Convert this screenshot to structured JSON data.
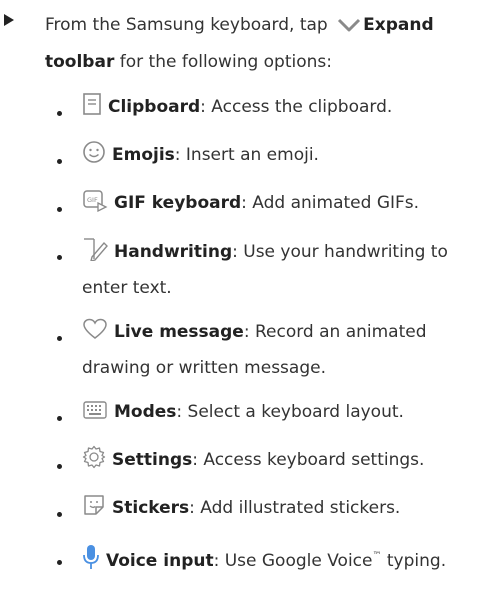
{
  "intro": {
    "before": "From the Samsung keyboard, tap ",
    "expand_bold": "Expand toolbar",
    "after": " for the following options:"
  },
  "options": [
    {
      "icon": "clipboard-icon",
      "label": "Clipboard",
      "desc": ": Access the clipboard."
    },
    {
      "icon": "emoji-icon",
      "label": "Emojis",
      "desc": ": Insert an emoji."
    },
    {
      "icon": "gif-icon",
      "label": "GIF keyboard",
      "desc": ": Add animated GIFs."
    },
    {
      "icon": "handwriting-icon",
      "label": "Handwriting",
      "desc": ": Use your handwriting to enter text."
    },
    {
      "icon": "live-message-icon",
      "label": "Live message",
      "desc": ": Record an animated drawing or written message."
    },
    {
      "icon": "keyboard-modes-icon",
      "label": "Modes",
      "desc": ": Select a keyboard layout."
    },
    {
      "icon": "settings-gear-icon",
      "label": "Settings",
      "desc": ": Access keyboard settings."
    },
    {
      "icon": "sticker-icon",
      "label": "Stickers",
      "desc": ": Add illustrated stickers."
    },
    {
      "icon": "microphone-icon",
      "label": "Voice input",
      "desc_before": ": Use Google Voice",
      "tm": "™",
      "desc_after": " typing."
    }
  ],
  "colors": {
    "text": "#333333",
    "icon": "#8a8a8a",
    "voice_icon": "#4a90e2"
  }
}
